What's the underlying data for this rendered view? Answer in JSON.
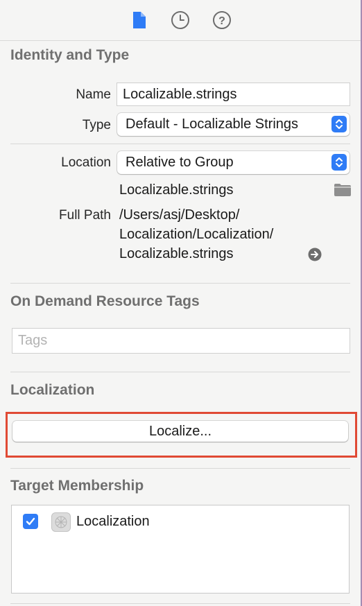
{
  "toolbar": {
    "icons": [
      "file-inspector-icon",
      "history-icon",
      "help-icon"
    ]
  },
  "identity": {
    "title": "Identity and Type",
    "name_label": "Name",
    "name_value": "Localizable.strings",
    "type_label": "Type",
    "type_value": "Default - Localizable Strings",
    "location_label": "Location",
    "location_value": "Relative to Group",
    "location_file": "Localizable.strings",
    "full_path_label": "Full Path",
    "full_path_lines": [
      "/Users/asj/Desktop/",
      "Localization/Localization/",
      "Localizable.strings"
    ]
  },
  "tags": {
    "title": "On Demand Resource Tags",
    "placeholder": "Tags"
  },
  "localization": {
    "title": "Localization",
    "button_label": "Localize..."
  },
  "membership": {
    "title": "Target Membership",
    "targets": [
      {
        "name": "Localization",
        "checked": true
      }
    ]
  },
  "colors": {
    "accent": "#2f7cf6",
    "highlight": "#e04a34"
  }
}
